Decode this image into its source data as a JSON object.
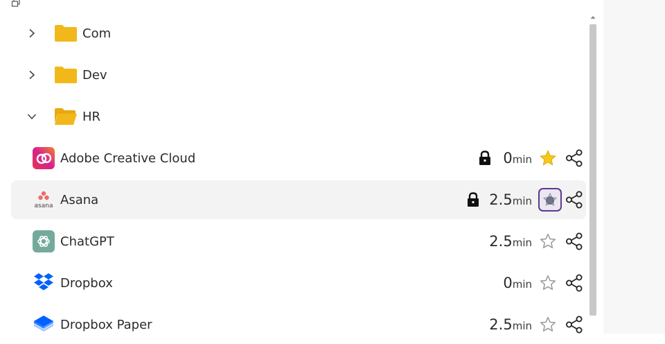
{
  "folders": [
    {
      "name": "Com",
      "expanded": false
    },
    {
      "name": "Dev",
      "expanded": false
    },
    {
      "name": "HR",
      "expanded": true
    }
  ],
  "apps": [
    {
      "name": "Adobe Creative Cloud",
      "locked": true,
      "duration": "0",
      "unit": "min",
      "favorite": true,
      "logo": "adobe-creative-cloud-logo"
    },
    {
      "name": "Asana",
      "locked": true,
      "duration": "2.5",
      "unit": "min",
      "favorite": false,
      "focused": true,
      "hovered": true,
      "logo": "asana-logo",
      "logo_text": "asana"
    },
    {
      "name": "ChatGPT",
      "locked": false,
      "duration": "2.5",
      "unit": "min",
      "favorite": false,
      "logo": "chatgpt-logo"
    },
    {
      "name": "Dropbox",
      "locked": false,
      "duration": "0",
      "unit": "min",
      "favorite": false,
      "logo": "dropbox-logo"
    },
    {
      "name": "Dropbox Paper",
      "locked": false,
      "duration": "2.5",
      "unit": "min",
      "favorite": false,
      "logo": "dropbox-paper-logo"
    }
  ],
  "colors": {
    "folder": "#f2b81a",
    "star_filled": "#f4c81e",
    "focus_ring": "#5b3a8a",
    "hover_row": "#f3f3f4",
    "scroll_thumb": "#c8c8c8"
  }
}
